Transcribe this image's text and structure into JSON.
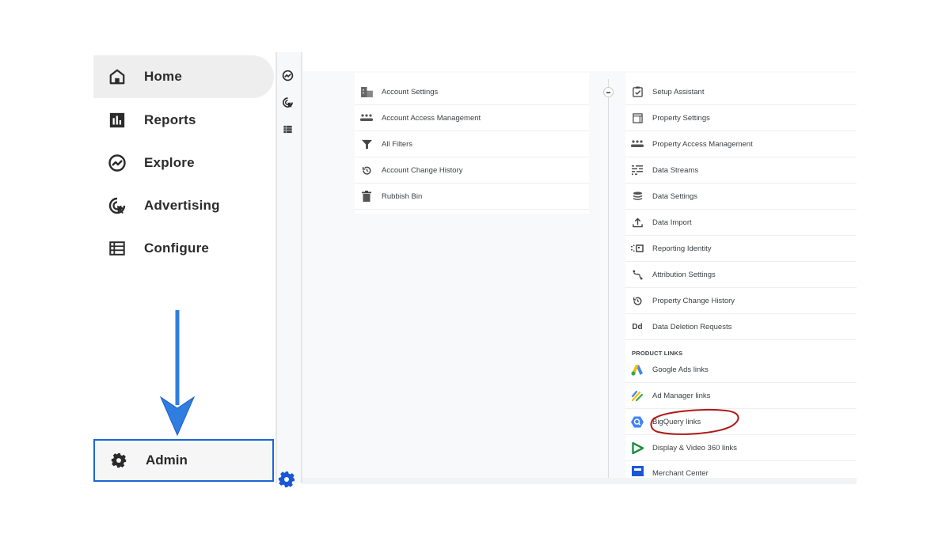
{
  "left_nav": {
    "items": [
      {
        "label": "Home",
        "icon": "home-icon",
        "active": true
      },
      {
        "label": "Reports",
        "icon": "reports-icon",
        "active": false
      },
      {
        "label": "Explore",
        "icon": "explore-icon",
        "active": false
      },
      {
        "label": "Advertising",
        "icon": "advertising-icon",
        "active": false
      },
      {
        "label": "Configure",
        "icon": "configure-icon",
        "active": false
      }
    ],
    "admin": {
      "label": "Admin",
      "icon": "gear-icon",
      "highlighted": true
    }
  },
  "annotation": {
    "arrow_color": "#2f7de1",
    "highlight_border_color": "#1a66d9",
    "circle_color": "#b01818",
    "circled_item": "BigQuery links"
  },
  "account_column": {
    "items": [
      {
        "label": "Account Settings",
        "icon": "account-settings-icon"
      },
      {
        "label": "Account Access Management",
        "icon": "people-icon"
      },
      {
        "label": "All Filters",
        "icon": "filter-icon"
      },
      {
        "label": "Account Change History",
        "icon": "history-icon"
      },
      {
        "label": "Rubbish Bin",
        "icon": "trash-icon"
      }
    ]
  },
  "property_column": {
    "items": [
      {
        "label": "Setup Assistant",
        "icon": "checklist-icon"
      },
      {
        "label": "Property Settings",
        "icon": "property-settings-icon"
      },
      {
        "label": "Property Access Management",
        "icon": "people-icon"
      },
      {
        "label": "Data Streams",
        "icon": "data-streams-icon"
      },
      {
        "label": "Data Settings",
        "icon": "database-icon"
      },
      {
        "label": "Data Import",
        "icon": "upload-icon"
      },
      {
        "label": "Reporting Identity",
        "icon": "reporting-identity-icon"
      },
      {
        "label": "Attribution Settings",
        "icon": "attribution-icon"
      },
      {
        "label": "Property Change History",
        "icon": "history-icon"
      },
      {
        "label": "Data Deletion Requests",
        "icon": "data-deletion-icon",
        "glyph": "Dd"
      }
    ],
    "product_links_heading": "PRODUCT LINKS",
    "product_links": [
      {
        "label": "Google Ads links",
        "icon": "google-ads-icon"
      },
      {
        "label": "Ad Manager links",
        "icon": "ad-manager-icon"
      },
      {
        "label": "BigQuery links",
        "icon": "bigquery-icon"
      },
      {
        "label": "Display & Video 360 links",
        "icon": "dv360-icon"
      },
      {
        "label": "Merchant Center",
        "icon": "merchant-center-icon"
      }
    ]
  }
}
